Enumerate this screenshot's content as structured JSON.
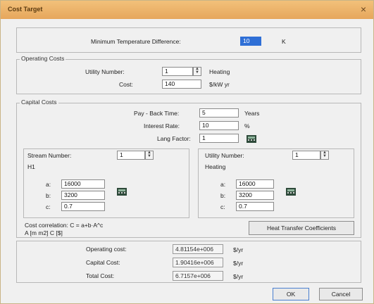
{
  "window": {
    "title": "Cost Target",
    "close_glyph": "×"
  },
  "min_temp": {
    "label": "Minimum Temperature Difference:",
    "value": "10",
    "unit": "K"
  },
  "operating": {
    "group_label": "Operating Costs",
    "utility_label": "Utility Number:",
    "utility_value": "1",
    "utility_type": "Heating",
    "cost_label": "Cost:",
    "cost_value": "140",
    "cost_unit": "$/kW yr"
  },
  "capital": {
    "group_label": "Capital Costs",
    "payback_label": "Pay - Back Time:",
    "payback_value": "5",
    "payback_unit": "Years",
    "interest_label": "Interest Rate:",
    "interest_value": "10",
    "interest_unit": "%",
    "lang_label": "Lang Factor:",
    "lang_value": "1",
    "stream": {
      "number_label": "Stream Number:",
      "number_value": "1",
      "stream_name": "H1",
      "a_label": "a:",
      "a_value": "16000",
      "b_label": "b:",
      "b_value": "3200",
      "c_label": "c:",
      "c_value": "0.7"
    },
    "utility": {
      "number_label": "Utility Number:",
      "number_value": "1",
      "utility_name": "Heating",
      "a_label": "a:",
      "a_value": "16000",
      "b_label": "b:",
      "b_value": "3200",
      "c_label": "c:",
      "c_value": "0.7"
    },
    "correlation_line1": "Cost correlation: C = a+b·A^c",
    "correlation_line2": "A [m m2]  C [$]",
    "htc_button": "Heat Transfer Coefficients"
  },
  "results": {
    "operating_label": "Operating cost:",
    "operating_value": "4.81154e+006",
    "operating_unit": "$/yr",
    "capital_label": "Capital Cost:",
    "capital_value": "1.90416e+006",
    "capital_unit": "$/yr",
    "total_label": "Total Cost:",
    "total_value": "6.7157e+006",
    "total_unit": "$/yr"
  },
  "buttons": {
    "ok": "OK",
    "cancel": "Cancel"
  },
  "colors": {
    "titlebar": "#e6a75c",
    "selection": "#2f6fd6"
  },
  "icons": [
    "calculator-icon",
    "spin-up-icon",
    "spin-down-icon",
    "close-icon"
  ]
}
